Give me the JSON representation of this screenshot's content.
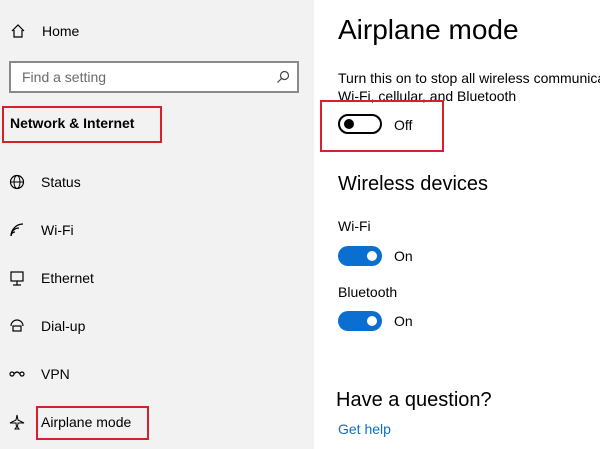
{
  "sidebar": {
    "home_label": "Home",
    "search_placeholder": "Find a setting",
    "section_title": "Network & Internet",
    "items": [
      {
        "label": "Status",
        "icon": "globe-icon"
      },
      {
        "label": "Wi-Fi",
        "icon": "wifi-icon"
      },
      {
        "label": "Ethernet",
        "icon": "ethernet-icon"
      },
      {
        "label": "Dial-up",
        "icon": "dialup-icon"
      },
      {
        "label": "VPN",
        "icon": "vpn-icon"
      },
      {
        "label": "Airplane mode",
        "icon": "airplane-icon"
      }
    ]
  },
  "main": {
    "title": "Airplane mode",
    "description_line1": "Turn this on to stop all wireless communications, like",
    "description_line2": "Wi-Fi, cellular, and Bluetooth",
    "airplane_toggle_state": "Off",
    "wireless_title": "Wireless devices",
    "devices": [
      {
        "label": "Wi-Fi",
        "state": "On"
      },
      {
        "label": "Bluetooth",
        "state": "On"
      }
    ],
    "question_title": "Have a question?",
    "help_link": "Get help"
  },
  "colors": {
    "accent": "#0a6fd1",
    "highlight_box": "#d7212a",
    "sidebar_bg": "#f2f2f2"
  }
}
